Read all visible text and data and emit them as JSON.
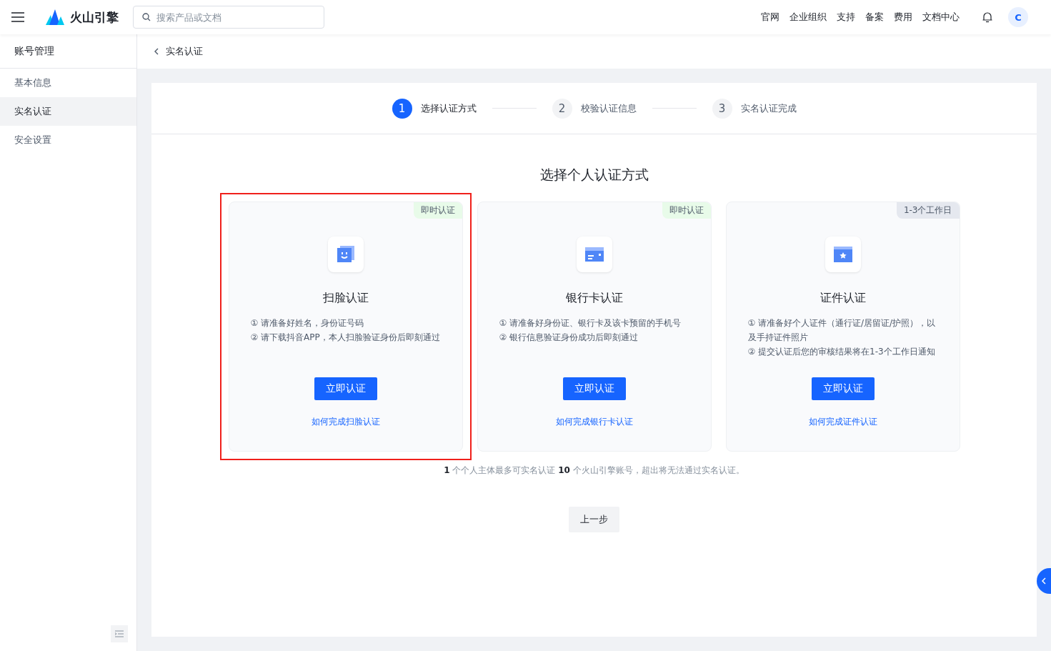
{
  "header": {
    "brand": "火山引擎",
    "search": {
      "placeholder": "搜索产品或文档"
    },
    "nav": [
      "官网",
      "企业组织",
      "支持",
      "备案",
      "费用",
      "文档中心"
    ],
    "avatar": "C"
  },
  "sidebar": {
    "title": "账号管理",
    "items": [
      {
        "label": "基本信息",
        "selected": false
      },
      {
        "label": "实名认证",
        "selected": true
      },
      {
        "label": "安全设置",
        "selected": false
      }
    ]
  },
  "breadcrumb": "实名认证",
  "steps": [
    {
      "number": "1",
      "label": "选择认证方式",
      "selected": true
    },
    {
      "number": "2",
      "label": "校验认证信息",
      "selected": false
    },
    {
      "number": "3",
      "label": "实名认证完成",
      "selected": false
    }
  ],
  "heading": "选择个人认证方式",
  "methods": [
    {
      "kind": "face",
      "tag": "即时认证",
      "color": "#e8fbe9",
      "highlighted": true,
      "title": "扫脸认证",
      "notes": [
        "① 请准备好姓名，身份证号码",
        "② 请下载抖音APP，本人扫脸验证身份后即刻通过"
      ],
      "button": "立即认证",
      "link": "如何完成扫脸认证"
    },
    {
      "kind": "bankcard",
      "tag": "即时认证",
      "color": "#e8fbe9",
      "highlighted": false,
      "title": "银行卡认证",
      "notes": [
        "① 请准备好身份证、银行卡及该卡预留的手机号",
        "② 银行信息验证身份成功后即刻通过"
      ],
      "button": "立即认证",
      "link": "如何完成银行卡认证"
    },
    {
      "kind": "document",
      "tag": "1-3个工作日",
      "color": "#e5e8ef",
      "highlighted": false,
      "title": "证件认证",
      "notes": [
        "① 请准备好个人证件（通行证/居留证/护照），以及手持证件照片",
        "② 提交认证后您的审核结果将在1-3个工作日通知"
      ],
      "button": "立即认证",
      "link": "如何完成证件认证"
    }
  ],
  "notice": "**1** 个个人主体最多可实名认证 **10** 个火山引擎账号，超出将无法通过实名认证。",
  "back_button": "上一步"
}
